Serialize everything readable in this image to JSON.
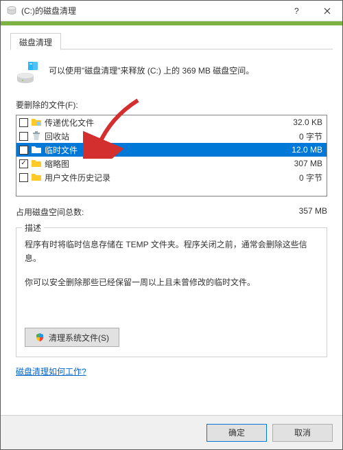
{
  "titlebar": {
    "title": "(C:)的磁盘清理"
  },
  "tab": {
    "label": "磁盘清理"
  },
  "intro": {
    "text": "可以使用\"磁盘清理\"来释放  (C:) 上的 369 MB 磁盘空间。"
  },
  "files_label": "要删除的文件(F):",
  "files": [
    {
      "name": "传递优化文件",
      "size": "32.0 KB",
      "checked": false,
      "selected": false,
      "icon": "delivery"
    },
    {
      "name": "回收站",
      "size": "0 字节",
      "checked": false,
      "selected": false,
      "icon": "recycle"
    },
    {
      "name": "临时文件",
      "size": "12.0 MB",
      "checked": false,
      "selected": true,
      "icon": "folder"
    },
    {
      "name": "缩略图",
      "size": "307 MB",
      "checked": true,
      "selected": false,
      "icon": "folder"
    },
    {
      "name": "用户文件历史记录",
      "size": "0 字节",
      "checked": false,
      "selected": false,
      "icon": "folder"
    }
  ],
  "total": {
    "label": "占用磁盘空间总数:",
    "value": "357 MB"
  },
  "desc": {
    "title": "描述",
    "p1": "程序有时将临时信息存储在 TEMP 文件夹。程序关闭之前，通常会删除这些信息。",
    "p2": "你可以安全删除那些已经保留一周以上且未曾修改的临时文件。"
  },
  "sys_button": "清理系统文件(S)",
  "help_link": "磁盘清理如何工作?",
  "footer": {
    "ok": "确定",
    "cancel": "取消"
  }
}
